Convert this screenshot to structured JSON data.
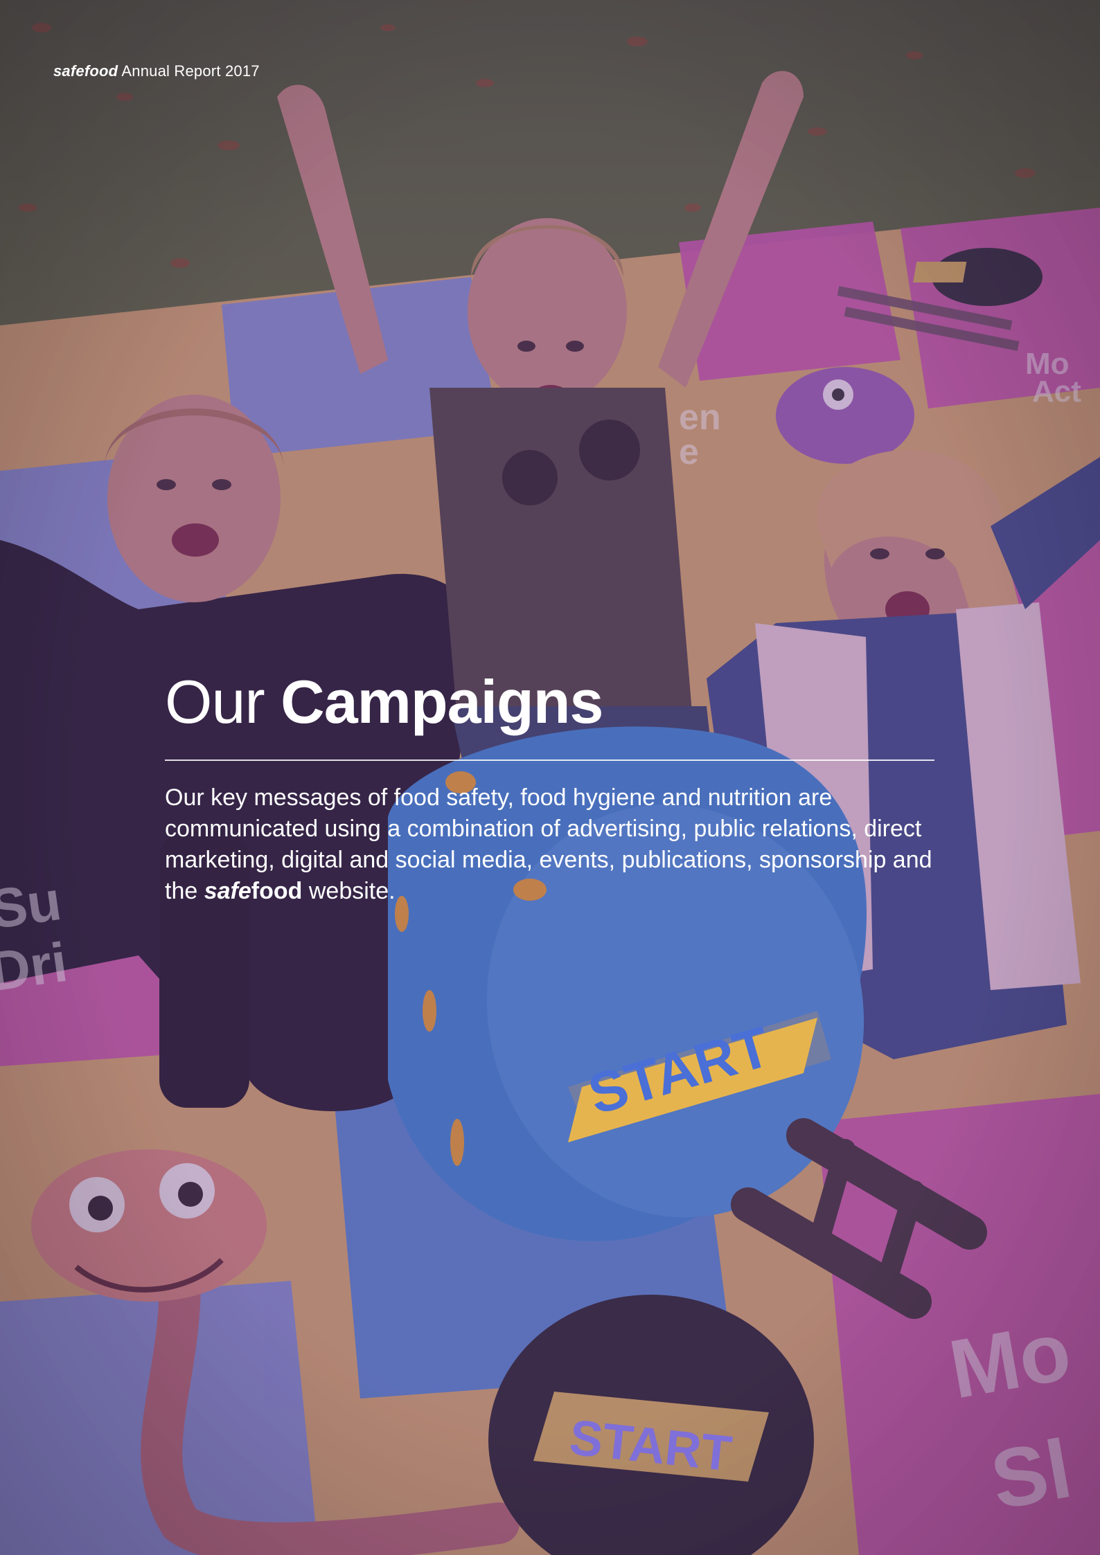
{
  "header": {
    "brand": "safefood",
    "report_label": "Annual Report 2017"
  },
  "section": {
    "title_light": "Our",
    "title_bold": "Campaigns",
    "intro_before": "Our key messages of food safety, food hygiene and nutrition are communicated using a combination of advertising, public relations, direct marketing, digital and social media, events, publications, sponsorship and the",
    "intro_brand_italic": "safe",
    "intro_brand_bold": "food",
    "intro_after": "website."
  },
  "image": {
    "description_icon": "children-playing-board-game-photo",
    "dice_label": "START",
    "mat_button_label": "START"
  },
  "colors": {
    "overlay": "#6a3f8a",
    "text": "#ffffff",
    "mat_pink": "#e04fa8",
    "mat_blue": "#5fa0e6",
    "mat_yellow": "#f2c46a",
    "dice_blue": "#3a86d4"
  }
}
